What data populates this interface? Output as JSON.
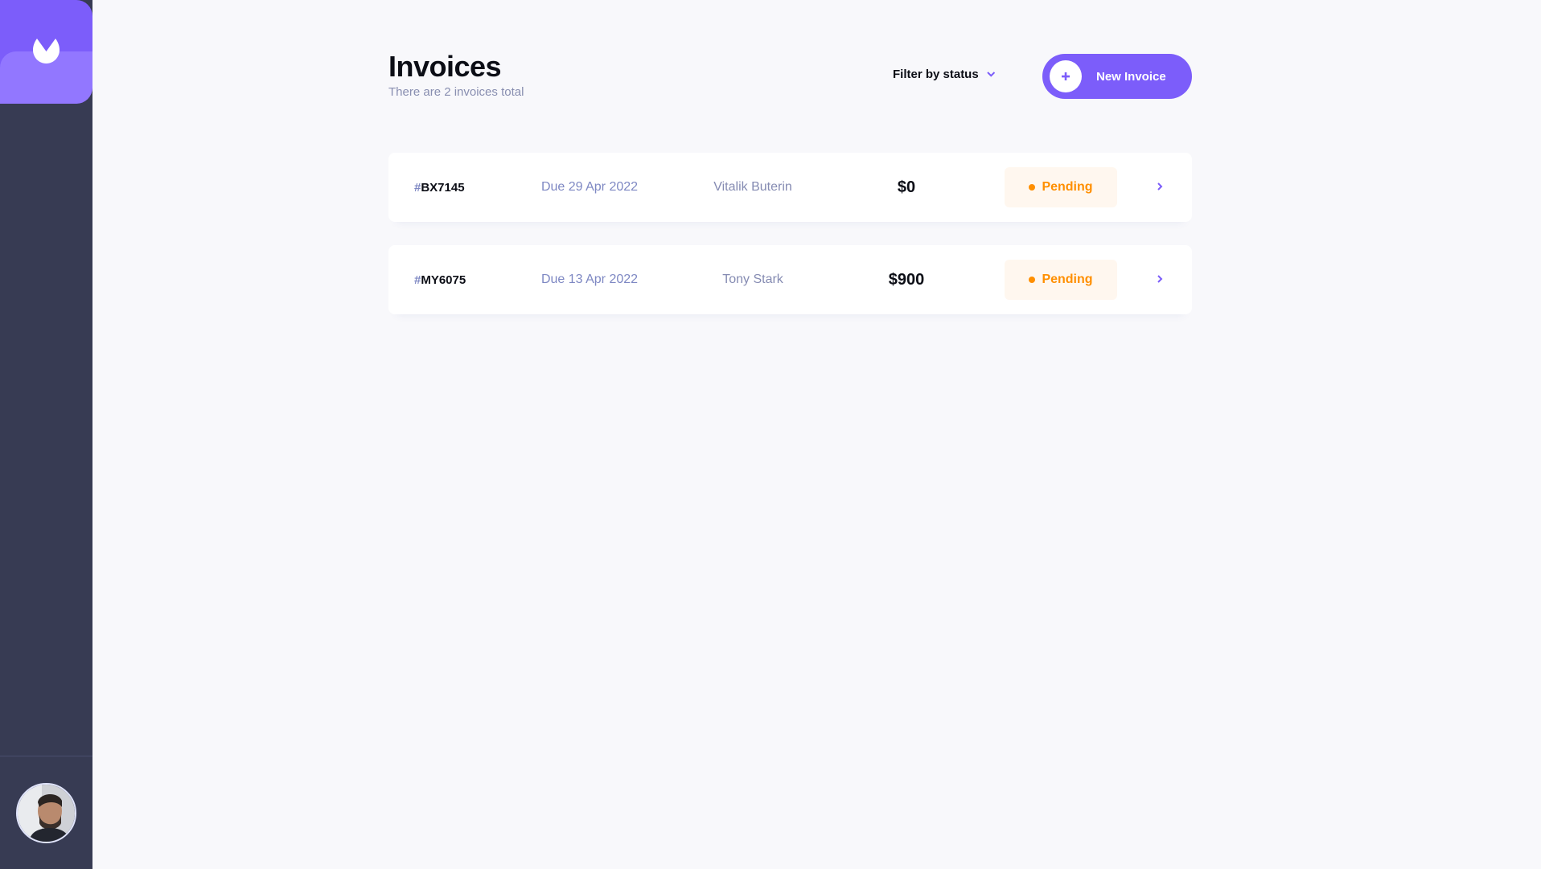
{
  "page": {
    "title": "Invoices",
    "subtitle": "There are 2 invoices total"
  },
  "toolbar": {
    "filter_label": "Filter by status",
    "new_invoice_label": "New Invoice"
  },
  "invoices": [
    {
      "hash": "#",
      "id": "BX7145",
      "due": "Due 29 Apr 2022",
      "client": "Vitalik Buterin",
      "amount": "$0",
      "status": "Pending"
    },
    {
      "hash": "#",
      "id": "MY6075",
      "due": "Due 13 Apr 2022",
      "client": "Tony Stark",
      "amount": "$900",
      "status": "Pending"
    }
  ],
  "colors": {
    "accent": "#7c5dfa",
    "accent_light": "#9277ff",
    "sidebar": "#373b53",
    "pending": "#ff8f00",
    "pending_bg": "#fff7ef",
    "muted_text": "#7e88c3"
  },
  "icons": {
    "logo": "logo-icon",
    "filter_chevron": "chevron-down-icon",
    "new_invoice": "plus-icon",
    "row_arrow": "chevron-right-icon",
    "status_dot": "status-dot-icon"
  }
}
